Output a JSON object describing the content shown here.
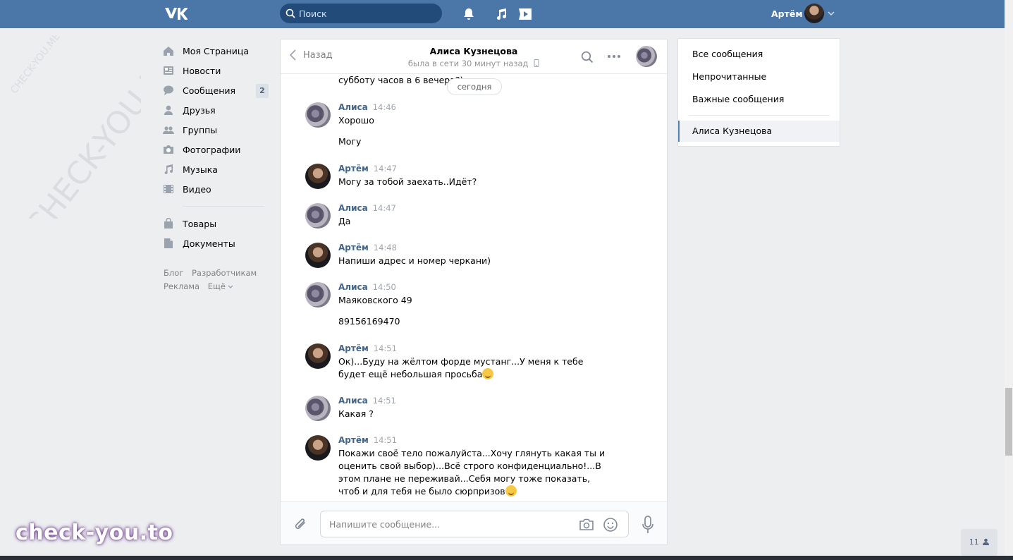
{
  "header": {
    "search_placeholder": "Поиск",
    "user_name": "Артём",
    "icons": [
      "vk-logo",
      "search-icon",
      "bell-icon",
      "music-icon",
      "video-icon",
      "chevron-down-icon"
    ]
  },
  "nav": {
    "items": [
      {
        "label": "Моя Страница",
        "icon": "home-icon"
      },
      {
        "label": "Новости",
        "icon": "news-icon"
      },
      {
        "label": "Сообщения",
        "icon": "messages-icon",
        "badge": "2"
      },
      {
        "label": "Друзья",
        "icon": "friends-icon"
      },
      {
        "label": "Группы",
        "icon": "groups-icon"
      },
      {
        "label": "Фотографии",
        "icon": "camera-icon"
      },
      {
        "label": "Музыка",
        "icon": "music-icon"
      },
      {
        "label": "Видео",
        "icon": "video-icon"
      }
    ],
    "items2": [
      {
        "label": "Товары",
        "icon": "bag-icon"
      },
      {
        "label": "Документы",
        "icon": "document-icon"
      }
    ],
    "footer": [
      "Блог",
      "Разработчикам",
      "Реклама",
      "Ещё"
    ]
  },
  "chat": {
    "back_label": "Назад",
    "title": "Алиса Кузнецова",
    "status": "была в сети 30 минут назад",
    "top_cut_text": "субботу часов в 6 вечера?)",
    "date_label": "сегодня",
    "messages": [
      {
        "author": "Алиса",
        "time": "14:46",
        "text": "Хорошо",
        "text2": "Могу"
      },
      {
        "author": "Артём",
        "time": "14:47",
        "text": "Могу за тобой заехать..Идёт?"
      },
      {
        "author": "Алиса",
        "time": "14:47",
        "text": "Да"
      },
      {
        "author": "Артём",
        "time": "14:48",
        "text": "Напиши адрес и номер черкани)"
      },
      {
        "author": "Алиса",
        "time": "14:50",
        "text": "Маяковского 49",
        "text2": "89156169470"
      },
      {
        "author": "Артём",
        "time": "14:51",
        "text": "Ок)...Буду на жёлтом форде мустанг...У меня к тебе будет ещё небольшая просьба"
      },
      {
        "author": "Алиса",
        "time": "14:51",
        "text": "Какая ?"
      },
      {
        "author": "Артём",
        "time": "14:51",
        "text": "Покажи своё тело пожалуйста...Хочу глянуть какая ты и оценить свой выбор)...Всё строго конфиденциально!...В этом плане не переживай...Себя могу тоже показать, чтоб и для тебя не было сюрпризов"
      }
    ],
    "composer_placeholder": "Напишите сообщение..."
  },
  "right_menu": {
    "items": [
      "Все сообщения",
      "Непрочитанные",
      "Важные сообщения"
    ],
    "active_dialog": "Алиса Кузнецова"
  },
  "watermark": {
    "bottom": "check-you.to",
    "diagonal": "CHECK-YOU.ME"
  },
  "online_counter": "11",
  "colors": {
    "accent": "#4a76a8",
    "link": "#42648b"
  }
}
